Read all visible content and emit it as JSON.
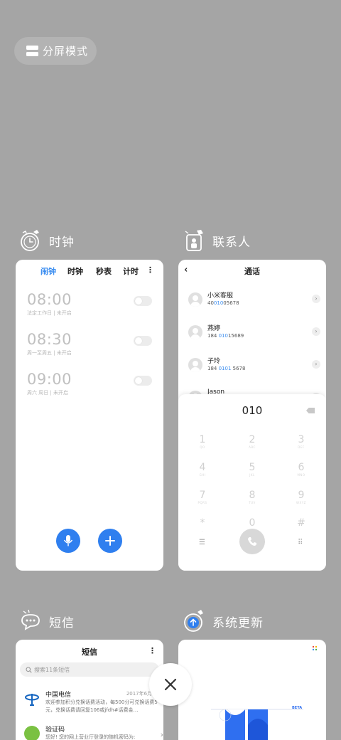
{
  "split_screen": {
    "label": "分屏模式"
  },
  "apps": [
    {
      "name": "时钟",
      "icon": "clock-icon"
    },
    {
      "name": "联系人",
      "icon": "contacts-icon"
    },
    {
      "name": "短信",
      "icon": "messages-icon"
    },
    {
      "name": "系统更新",
      "icon": "system-update-icon"
    }
  ],
  "clock": {
    "tabs": [
      "闹钟",
      "时钟",
      "秒表",
      "计时"
    ],
    "active_tab": "闹钟",
    "more": "⋮",
    "alarms": [
      {
        "time": "08:00",
        "detail": "法定工作日 | 未开启",
        "enabled": false
      },
      {
        "time": "08:30",
        "detail": "周一至周五 | 未开启",
        "enabled": false
      },
      {
        "time": "09:00",
        "detail": "周六 周日 | 未开启",
        "enabled": false
      }
    ]
  },
  "contacts": {
    "title": "通话",
    "dial_input": "010",
    "entries": [
      {
        "name": "小米客服",
        "num_pre": "40",
        "num_hl": "010",
        "num_post": "05678"
      },
      {
        "name": "燕婷",
        "num_pre": "184 ",
        "num_hl": "010",
        "num_post": "15689"
      },
      {
        "name": "子玲",
        "num_pre": "184 ",
        "num_hl": "0101",
        "num_post": " 5678"
      },
      {
        "name": "Jason",
        "num_pre": "",
        "num_hl": "",
        "num_post": ""
      }
    ],
    "keypad": [
      {
        "digit": "1",
        "letters": "QO"
      },
      {
        "digit": "2",
        "letters": "ABC"
      },
      {
        "digit": "3",
        "letters": "DEF"
      },
      {
        "digit": "4",
        "letters": "GHI"
      },
      {
        "digit": "5",
        "letters": "JKL"
      },
      {
        "digit": "6",
        "letters": "MNO"
      },
      {
        "digit": "7",
        "letters": "PQRS"
      },
      {
        "digit": "8",
        "letters": "TUV"
      },
      {
        "digit": "9",
        "letters": "WXYZ"
      },
      {
        "digit": "*",
        "letters": ","
      },
      {
        "digit": "0",
        "letters": "+"
      },
      {
        "digit": "#",
        "letters": ""
      }
    ]
  },
  "messages": {
    "title": "短信",
    "search_placeholder": "搜索11条短信",
    "items": [
      {
        "sender": "中国电信",
        "date": "2017年6月30日",
        "preview": "欢迎参加积分兑换话费活动，每500分可兑换话费5元，兑换话费请回复106或jfdh#话费金…"
      },
      {
        "sender": "验证码",
        "date": "",
        "preview": "您好! 您的网上营业厅登录的随机密码为:"
      }
    ]
  },
  "system_update": {
    "badge": "BETA"
  },
  "colors": {
    "accent": "#3c8ef0",
    "fab": "#2f7fef",
    "background": "#a5a5a5"
  }
}
